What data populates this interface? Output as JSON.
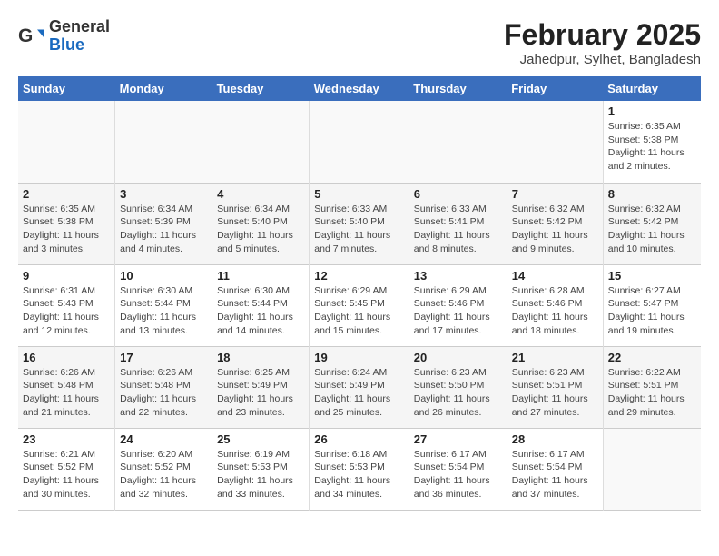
{
  "logo": {
    "general": "General",
    "blue": "Blue"
  },
  "calendar": {
    "title": "February 2025",
    "subtitle": "Jahedpur, Sylhet, Bangladesh"
  },
  "weekdays": [
    "Sunday",
    "Monday",
    "Tuesday",
    "Wednesday",
    "Thursday",
    "Friday",
    "Saturday"
  ],
  "weeks": [
    [
      {
        "day": "",
        "info": ""
      },
      {
        "day": "",
        "info": ""
      },
      {
        "day": "",
        "info": ""
      },
      {
        "day": "",
        "info": ""
      },
      {
        "day": "",
        "info": ""
      },
      {
        "day": "",
        "info": ""
      },
      {
        "day": "1",
        "info": "Sunrise: 6:35 AM\nSunset: 5:38 PM\nDaylight: 11 hours and 2 minutes."
      }
    ],
    [
      {
        "day": "2",
        "info": "Sunrise: 6:35 AM\nSunset: 5:38 PM\nDaylight: 11 hours and 3 minutes."
      },
      {
        "day": "3",
        "info": "Sunrise: 6:34 AM\nSunset: 5:39 PM\nDaylight: 11 hours and 4 minutes."
      },
      {
        "day": "4",
        "info": "Sunrise: 6:34 AM\nSunset: 5:40 PM\nDaylight: 11 hours and 5 minutes."
      },
      {
        "day": "5",
        "info": "Sunrise: 6:33 AM\nSunset: 5:40 PM\nDaylight: 11 hours and 7 minutes."
      },
      {
        "day": "6",
        "info": "Sunrise: 6:33 AM\nSunset: 5:41 PM\nDaylight: 11 hours and 8 minutes."
      },
      {
        "day": "7",
        "info": "Sunrise: 6:32 AM\nSunset: 5:42 PM\nDaylight: 11 hours and 9 minutes."
      },
      {
        "day": "8",
        "info": "Sunrise: 6:32 AM\nSunset: 5:42 PM\nDaylight: 11 hours and 10 minutes."
      }
    ],
    [
      {
        "day": "9",
        "info": "Sunrise: 6:31 AM\nSunset: 5:43 PM\nDaylight: 11 hours and 12 minutes."
      },
      {
        "day": "10",
        "info": "Sunrise: 6:30 AM\nSunset: 5:44 PM\nDaylight: 11 hours and 13 minutes."
      },
      {
        "day": "11",
        "info": "Sunrise: 6:30 AM\nSunset: 5:44 PM\nDaylight: 11 hours and 14 minutes."
      },
      {
        "day": "12",
        "info": "Sunrise: 6:29 AM\nSunset: 5:45 PM\nDaylight: 11 hours and 15 minutes."
      },
      {
        "day": "13",
        "info": "Sunrise: 6:29 AM\nSunset: 5:46 PM\nDaylight: 11 hours and 17 minutes."
      },
      {
        "day": "14",
        "info": "Sunrise: 6:28 AM\nSunset: 5:46 PM\nDaylight: 11 hours and 18 minutes."
      },
      {
        "day": "15",
        "info": "Sunrise: 6:27 AM\nSunset: 5:47 PM\nDaylight: 11 hours and 19 minutes."
      }
    ],
    [
      {
        "day": "16",
        "info": "Sunrise: 6:26 AM\nSunset: 5:48 PM\nDaylight: 11 hours and 21 minutes."
      },
      {
        "day": "17",
        "info": "Sunrise: 6:26 AM\nSunset: 5:48 PM\nDaylight: 11 hours and 22 minutes."
      },
      {
        "day": "18",
        "info": "Sunrise: 6:25 AM\nSunset: 5:49 PM\nDaylight: 11 hours and 23 minutes."
      },
      {
        "day": "19",
        "info": "Sunrise: 6:24 AM\nSunset: 5:49 PM\nDaylight: 11 hours and 25 minutes."
      },
      {
        "day": "20",
        "info": "Sunrise: 6:23 AM\nSunset: 5:50 PM\nDaylight: 11 hours and 26 minutes."
      },
      {
        "day": "21",
        "info": "Sunrise: 6:23 AM\nSunset: 5:51 PM\nDaylight: 11 hours and 27 minutes."
      },
      {
        "day": "22",
        "info": "Sunrise: 6:22 AM\nSunset: 5:51 PM\nDaylight: 11 hours and 29 minutes."
      }
    ],
    [
      {
        "day": "23",
        "info": "Sunrise: 6:21 AM\nSunset: 5:52 PM\nDaylight: 11 hours and 30 minutes."
      },
      {
        "day": "24",
        "info": "Sunrise: 6:20 AM\nSunset: 5:52 PM\nDaylight: 11 hours and 32 minutes."
      },
      {
        "day": "25",
        "info": "Sunrise: 6:19 AM\nSunset: 5:53 PM\nDaylight: 11 hours and 33 minutes."
      },
      {
        "day": "26",
        "info": "Sunrise: 6:18 AM\nSunset: 5:53 PM\nDaylight: 11 hours and 34 minutes."
      },
      {
        "day": "27",
        "info": "Sunrise: 6:17 AM\nSunset: 5:54 PM\nDaylight: 11 hours and 36 minutes."
      },
      {
        "day": "28",
        "info": "Sunrise: 6:17 AM\nSunset: 5:54 PM\nDaylight: 11 hours and 37 minutes."
      },
      {
        "day": "",
        "info": ""
      }
    ]
  ]
}
